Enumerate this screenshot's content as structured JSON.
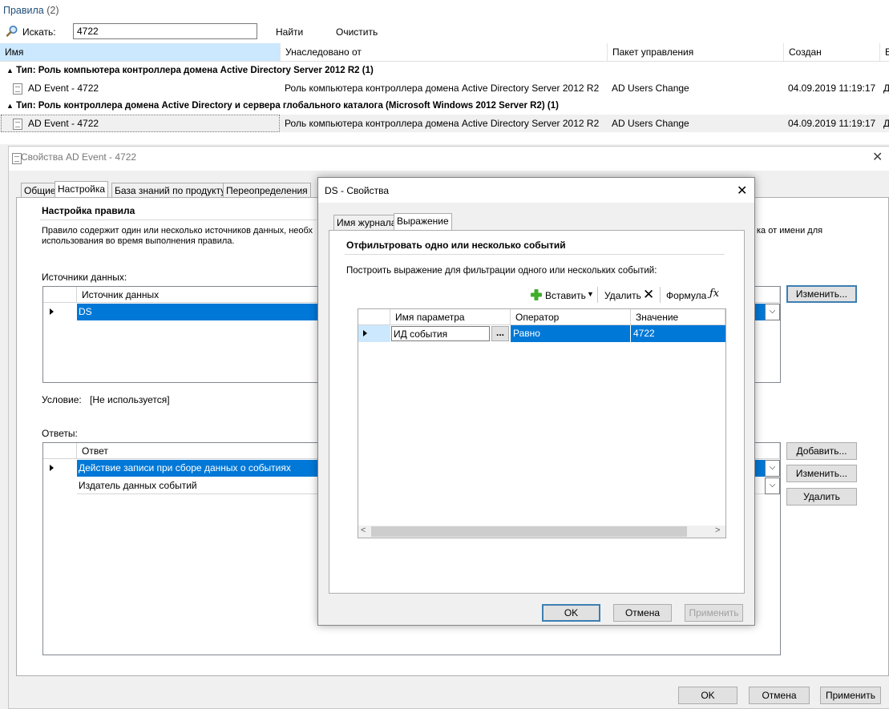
{
  "rules_panel": {
    "title": "Правила",
    "count": "(2)",
    "search_label": "Искать:",
    "search_value": "4722",
    "find_label": "Найти",
    "clear_label": "Очистить",
    "columns": [
      "Имя",
      "Унаследовано от",
      "Пакет управления",
      "Создан",
      "Е"
    ],
    "groups": [
      {
        "header": "Тип: Роль компьютера контроллера домена Active Directory Server 2012 R2 (1)",
        "row": {
          "name": "AD Event - 4722",
          "inherited": "Роль компьютера контроллера домена Active Directory Server 2012 R2",
          "pack": "AD Users Change",
          "created": "04.09.2019 11:19:17",
          "extra": "Д"
        }
      },
      {
        "header": "Тип: Роль контроллера домена Active Directory и сервера глобального каталога (Microsoft Windows 2012 Server R2) (1)",
        "row": {
          "name": "AD Event - 4722",
          "inherited": "Роль компьютера контроллера домена Active Directory Server 2012 R2",
          "pack": "AD Users Change",
          "created": "04.09.2019 11:19:17",
          "extra": "Д"
        }
      }
    ]
  },
  "props_window": {
    "title": "Свойства AD Event - 4722",
    "tabs": [
      "Общие",
      "Настройка",
      "База знаний по продукту",
      "Переопределения"
    ],
    "section_title": "Настройка правила",
    "description_left": "Правило содержит один или несколько источников данных, необх",
    "description_right": "ка от имени для",
    "description_line2": "использования во время выполнения правила.",
    "data_sources_label": "Источники данных:",
    "data_sources_column": "Источник данных",
    "data_sources_rows": [
      "DS"
    ],
    "condition_label": "Условие:",
    "condition_value": "[Не используется]",
    "responses_label": "Ответы:",
    "responses_column": "Ответ",
    "responses_rows": [
      "Действие записи при сборе данных о событиях",
      "Издатель данных событий"
    ],
    "edit_button": "Изменить...",
    "add_button": "Добавить...",
    "edit_button2": "Изменить...",
    "delete_button": "Удалить",
    "ok": "OK",
    "cancel": "Отмена",
    "apply": "Применить"
  },
  "ds_dialog": {
    "title": "DS - Свойства",
    "tabs": [
      "Имя журнала",
      "Выражение"
    ],
    "section_title": "Отфильтровать одно или несколько событий",
    "description": "Построить выражение для фильтрации одного или нескольких событий:",
    "toolbar": {
      "insert": "Вставить",
      "delete": "Удалить",
      "formula": "Формула"
    },
    "columns": [
      "Имя параметра",
      "Оператор",
      "Значение"
    ],
    "rows": [
      {
        "param": "ИД события",
        "ellipsis": "...",
        "operator": "Равно",
        "value": "4722"
      }
    ],
    "ok": "OK",
    "cancel": "Отмена",
    "apply": "Применить"
  },
  "colors": {
    "selection": "#0078d7",
    "header_highlight": "#cce8ff",
    "title_blue": "#1e4e79"
  }
}
